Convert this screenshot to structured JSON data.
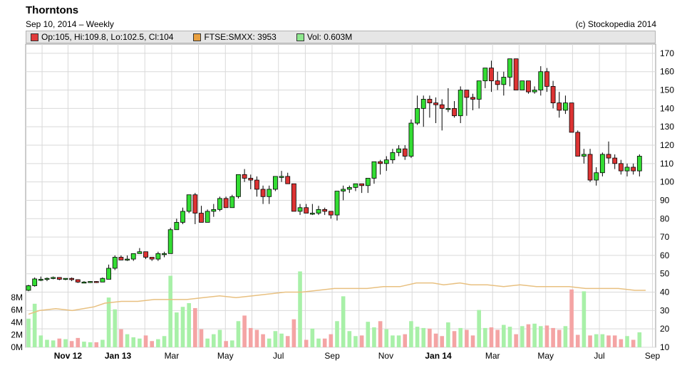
{
  "header": {
    "title": "Thorntons",
    "subtitle": "Sep 10, 2014 – Weekly",
    "credit": "(c) Stockopedia 2014"
  },
  "legend": [
    {
      "label": "Op:105, Hi:109.8, Lo:102.5, Cl:104",
      "color": "#e03c3c"
    },
    {
      "label": "FTSE:SMXX: 3953",
      "color": "#e8a040"
    },
    {
      "label": "Vol: 0.603M",
      "color": "#8ee88e"
    }
  ],
  "colors": {
    "up": "#33dd33",
    "down": "#dd3333",
    "vol_up": "#a8f0a8",
    "vol_down": "#f4a4a4",
    "ftse": "#e8c080",
    "grid": "#d9d9d9"
  },
  "chart_data": {
    "type": "candlestick",
    "frequency": "weekly",
    "price_axis": {
      "range": [
        10,
        175
      ],
      "ticks": [
        10,
        20,
        30,
        40,
        50,
        60,
        70,
        80,
        90,
        100,
        110,
        120,
        130,
        140,
        150,
        160,
        170
      ],
      "side": "right"
    },
    "volume_axis": {
      "range": [
        0,
        9.5
      ],
      "unit": "M",
      "ticks": [
        "0M",
        "2M",
        "4M",
        "6M",
        "8M"
      ],
      "side": "left"
    },
    "x_axis": {
      "ticks": [
        {
          "label": "Nov 12",
          "week": 6.4,
          "bold": true
        },
        {
          "label": "Jan 13",
          "week": 14.5,
          "bold": true
        },
        {
          "label": "Mar",
          "week": 23.2,
          "bold": false
        },
        {
          "label": "May",
          "week": 31.9,
          "bold": false
        },
        {
          "label": "Jul",
          "week": 40.5,
          "bold": false
        },
        {
          "label": "Sep",
          "week": 49.2,
          "bold": false
        },
        {
          "label": "Nov",
          "week": 57.9,
          "bold": false
        },
        {
          "label": "Jan 14",
          "week": 66.4,
          "bold": true
        },
        {
          "label": "Mar",
          "week": 75.2,
          "bold": false
        },
        {
          "label": "May",
          "week": 83.8,
          "bold": false
        },
        {
          "label": "Jul",
          "week": 92.5,
          "bold": false
        },
        {
          "label": "Sep",
          "week": 101.1,
          "bold": false
        }
      ]
    },
    "grid": true,
    "candles": [
      [
        0,
        41,
        44,
        40.5,
        43.5,
        4.6
      ],
      [
        1,
        43.5,
        48,
        43,
        47.2,
        7.0
      ],
      [
        2,
        47,
        48.5,
        46,
        47,
        1.9
      ],
      [
        3,
        47,
        48,
        46,
        47.5,
        1.2
      ],
      [
        4,
        47.5,
        48.5,
        47,
        48,
        1.1
      ],
      [
        5,
        48,
        48,
        46.5,
        47,
        1.4
      ],
      [
        6,
        47,
        47.5,
        46.5,
        47.5,
        1.3
      ],
      [
        7,
        47.5,
        48,
        46,
        46.8,
        1.0
      ],
      [
        8,
        46.8,
        47,
        45,
        45.5,
        1.5
      ],
      [
        9,
        45.5,
        46,
        45,
        45.5,
        0.9
      ],
      [
        10,
        45.5,
        46,
        45,
        45.8,
        0.8
      ],
      [
        11,
        45.8,
        46,
        45,
        45.5,
        0.8
      ],
      [
        12,
        45.5,
        48,
        45.5,
        47.5,
        1.2
      ],
      [
        13,
        47,
        55,
        47,
        53,
        8.0
      ],
      [
        14,
        53,
        60,
        52,
        59,
        6.1
      ],
      [
        15,
        59,
        60,
        58,
        57.5,
        2.9
      ],
      [
        16,
        57.5,
        60,
        57,
        58,
        2.1
      ],
      [
        17,
        58,
        61,
        57,
        61,
        1.6
      ],
      [
        18,
        61,
        64,
        61,
        62,
        1.4
      ],
      [
        19,
        62,
        62,
        58,
        59,
        1.9
      ],
      [
        20,
        59,
        59,
        57,
        58,
        1.0
      ],
      [
        21,
        58,
        62,
        57,
        61,
        1.3
      ],
      [
        22,
        61,
        62,
        59,
        61,
        1.8
      ],
      [
        23,
        61,
        75,
        61,
        74,
        11.5
      ],
      [
        24,
        74,
        80,
        74,
        78,
        5.6
      ],
      [
        25,
        78,
        86,
        77,
        84,
        6.5
      ],
      [
        26,
        84,
        90,
        83,
        93,
        7.1
      ],
      [
        27,
        93,
        94,
        77,
        83,
        6.3
      ],
      [
        28,
        83,
        87,
        79,
        78,
        2.9
      ],
      [
        29,
        78,
        85,
        78,
        84,
        1.4
      ],
      [
        30,
        84,
        88,
        81,
        85,
        2.1
      ],
      [
        31,
        85,
        92,
        84,
        91,
        2.8
      ],
      [
        32,
        91,
        92,
        86,
        86,
        1.0
      ],
      [
        33,
        86,
        93,
        86,
        92,
        1.1
      ],
      [
        34,
        92,
        103,
        91,
        104,
        4.2
      ],
      [
        35,
        104,
        107,
        100,
        102,
        5.1
      ],
      [
        36,
        102,
        104,
        96,
        101,
        3.1
      ],
      [
        37,
        101,
        103,
        92,
        96,
        2.8
      ],
      [
        38,
        96,
        98,
        88,
        92,
        2.1
      ],
      [
        39,
        92,
        98,
        88,
        96,
        1.4
      ],
      [
        40,
        96,
        101,
        95,
        103,
        2.6
      ],
      [
        41,
        103,
        106,
        100,
        103,
        2.2
      ],
      [
        42,
        103,
        105,
        99,
        99,
        1.8
      ],
      [
        43,
        99,
        99,
        84,
        84,
        4.5
      ],
      [
        44,
        84,
        88,
        82,
        86,
        12.2
      ],
      [
        45,
        86,
        88,
        83,
        83,
        1.2
      ],
      [
        46,
        83,
        88,
        82,
        83,
        3.0
      ],
      [
        47,
        83,
        87,
        82,
        85,
        1.4
      ],
      [
        48,
        85,
        86,
        82,
        84,
        1.4
      ],
      [
        49,
        84,
        84,
        80,
        82,
        2.1
      ],
      [
        50,
        82,
        90,
        79,
        95,
        4.2
      ],
      [
        51,
        95,
        98,
        90,
        96,
        8.2
      ],
      [
        52,
        96,
        98,
        94,
        97,
        2.6
      ],
      [
        53,
        97,
        99,
        95,
        99,
        1.8
      ],
      [
        54,
        99,
        99,
        94,
        98,
        1.9
      ],
      [
        55,
        98,
        100,
        94,
        102,
        4.1
      ],
      [
        56,
        102,
        111,
        99,
        111,
        3.2
      ],
      [
        57,
        111,
        112,
        104,
        110,
        4.2
      ],
      [
        58,
        110,
        114,
        106,
        112,
        2.9
      ],
      [
        59,
        112,
        118,
        110,
        116,
        1.9
      ],
      [
        60,
        116,
        120,
        114,
        118,
        1.9
      ],
      [
        61,
        118,
        120,
        112,
        114,
        2.1
      ],
      [
        62,
        114,
        134,
        113,
        132,
        4.2
      ],
      [
        63,
        132,
        147,
        131,
        140,
        3.3
      ],
      [
        64,
        140,
        147,
        130,
        145,
        3.1
      ],
      [
        65,
        145,
        147,
        135,
        143,
        3.0
      ],
      [
        66,
        143,
        146,
        132,
        142,
        2.2
      ],
      [
        67,
        142,
        145,
        128,
        140,
        1.8
      ],
      [
        68,
        140,
        151,
        138,
        140,
        4.0
      ],
      [
        69,
        140,
        144,
        135,
        136,
        2.6
      ],
      [
        70,
        136,
        152,
        132,
        150,
        3.1
      ],
      [
        71,
        150,
        150,
        136,
        146,
        2.8
      ],
      [
        72,
        146,
        148,
        139,
        145,
        1.9
      ],
      [
        73,
        145,
        155,
        140,
        155,
        6.0
      ],
      [
        74,
        155,
        162,
        151,
        162,
        3.1
      ],
      [
        75,
        162,
        166,
        149,
        155,
        3.2
      ],
      [
        76,
        155,
        160,
        150,
        153,
        2.8
      ],
      [
        77,
        153,
        160,
        147,
        157,
        3.6
      ],
      [
        78,
        157,
        165,
        152,
        167,
        3.3
      ],
      [
        79,
        167,
        167,
        153,
        150,
        2.1
      ],
      [
        80,
        150,
        154,
        150,
        155,
        3.4
      ],
      [
        81,
        155,
        155,
        148,
        149,
        3.7
      ],
      [
        82,
        149,
        152,
        148,
        150,
        3.8
      ],
      [
        83,
        150,
        163,
        147,
        160,
        3.4
      ],
      [
        84,
        160,
        162,
        149,
        152,
        3.5
      ],
      [
        85,
        152,
        155,
        140,
        143,
        3.1
      ],
      [
        86,
        143,
        149,
        135,
        139,
        2.8
      ],
      [
        87,
        139,
        147,
        137,
        143,
        3.4
      ],
      [
        88,
        143,
        143,
        127,
        127,
        9.3
      ],
      [
        89,
        127,
        128,
        114,
        114,
        2.0
      ],
      [
        90,
        114,
        118,
        110,
        115,
        9.0
      ],
      [
        91,
        115,
        118,
        100,
        101,
        1.9
      ],
      [
        92,
        101,
        108,
        98,
        105,
        2.1
      ],
      [
        93,
        105,
        116,
        103,
        115,
        2.1
      ],
      [
        94,
        115,
        122,
        110,
        113,
        1.9
      ],
      [
        95,
        113,
        115,
        107,
        110,
        1.9
      ],
      [
        96,
        110,
        112,
        104,
        106,
        1.3
      ],
      [
        97,
        106,
        110,
        103,
        108,
        1.8
      ],
      [
        98,
        108,
        110,
        104,
        106,
        1.2
      ],
      [
        99,
        106,
        115,
        103,
        114,
        2.4
      ]
    ],
    "ftse_line": [
      [
        0,
        28
      ],
      [
        2,
        30
      ],
      [
        5,
        31
      ],
      [
        8,
        30
      ],
      [
        12,
        32
      ],
      [
        14,
        34
      ],
      [
        17,
        35
      ],
      [
        20,
        35
      ],
      [
        23,
        36
      ],
      [
        26,
        36
      ],
      [
        29,
        36
      ],
      [
        32,
        37
      ],
      [
        35,
        38
      ],
      [
        38,
        37
      ],
      [
        41,
        38
      ],
      [
        44,
        39
      ],
      [
        47,
        40
      ],
      [
        50,
        40
      ],
      [
        53,
        41
      ],
      [
        56,
        42
      ],
      [
        59,
        42
      ],
      [
        62,
        42
      ],
      [
        65,
        43
      ],
      [
        68,
        43
      ],
      [
        71,
        45
      ],
      [
        74,
        45
      ],
      [
        76,
        44
      ],
      [
        79,
        45
      ],
      [
        81,
        44
      ],
      [
        84,
        44
      ],
      [
        87,
        43
      ],
      [
        90,
        44
      ],
      [
        93,
        43
      ],
      [
        96,
        43
      ],
      [
        99,
        43
      ],
      [
        102,
        42
      ],
      [
        105,
        42
      ],
      [
        108,
        42
      ],
      [
        111,
        41
      ],
      [
        113,
        41
      ]
    ]
  }
}
